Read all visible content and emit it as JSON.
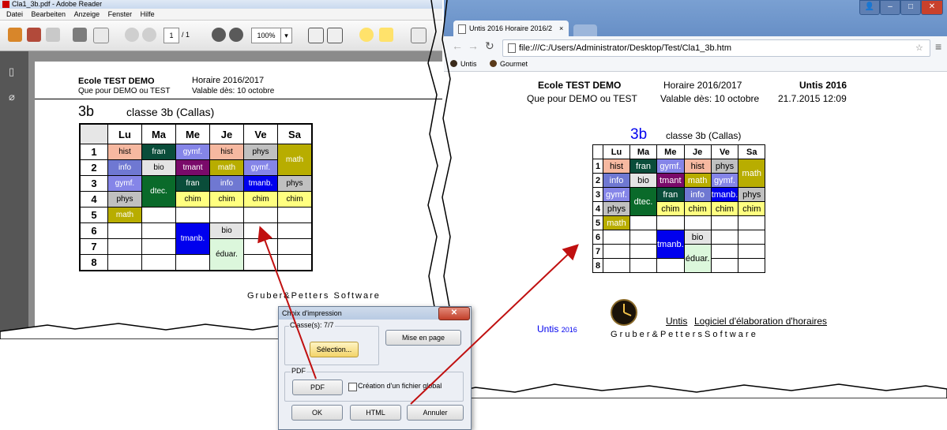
{
  "reader": {
    "title": "Cla1_3b.pdf - Adobe Reader",
    "menu": [
      "Datei",
      "Bearbeiten",
      "Anzeige",
      "Fenster",
      "Hilfe"
    ],
    "page_input": "1",
    "page_total": "/ 1",
    "zoom": "100%"
  },
  "school": {
    "name": "Ecole TEST  DEMO",
    "subtitle": "Que pour DEMO ou TEST",
    "schedule": "Horaire 2016/2017",
    "valid": "Valable dès: 10 octobre"
  },
  "pdf_class": {
    "code": "3b",
    "name": "classe 3b (Callas)"
  },
  "days": [
    "Lu",
    "Ma",
    "Me",
    "Je",
    "Ve",
    "Sa"
  ],
  "periods": [
    "1",
    "2",
    "3",
    "4",
    "5",
    "6",
    "7",
    "8"
  ],
  "lessons": {
    "hist": {
      "label": "hist",
      "bg": "#f6b8a0",
      "fg": "#000000"
    },
    "fran": {
      "label": "fran",
      "bg": "#0a4d3a",
      "fg": "#ffffff"
    },
    "gymf": {
      "label": "gymf.",
      "bg": "#8585e8",
      "fg": "#ffffff"
    },
    "phys": {
      "label": "phys",
      "bg": "#c0c0c0",
      "fg": "#000000"
    },
    "math": {
      "label": "math",
      "bg": "#b8ad00",
      "fg": "#ffffff"
    },
    "info": {
      "label": "info",
      "bg": "#6f78d2",
      "fg": "#ffffff"
    },
    "bio": {
      "label": "bio",
      "bg": "#e4e4e4",
      "fg": "#000000"
    },
    "tmant": {
      "label": "tmant",
      "bg": "#7a0a6a",
      "fg": "#ffffff"
    },
    "dtec": {
      "label": "dtec.",
      "bg": "#0a6a2a",
      "fg": "#ffffff"
    },
    "tmanb": {
      "label": "tmanb.",
      "bg": "#0000ee",
      "fg": "#ffffff"
    },
    "chim": {
      "label": "chim",
      "bg": "#ffff80",
      "fg": "#000000"
    },
    "educ": {
      "label": "éduar.",
      "bg": "#dcf7dc",
      "fg": "#000000"
    }
  },
  "pdf_footer": "Gruber&Petters Software",
  "browser": {
    "tab_title": "Untis 2016 Horaire 2016/2",
    "url": "file:///C:/Users/Administrator/Desktop/Test/Cla1_3b.htm",
    "bookmarks": [
      "Untis",
      "Gourmet"
    ]
  },
  "html_header": {
    "name": "Ecole TEST DEMO",
    "subtitle": "Que pour DEMO ou TEST",
    "schedule": "Horaire 2016/2017",
    "valid": "Valable dès: 10 octobre",
    "product": "Untis 2016",
    "timestamp": "21.7.2015 12:09"
  },
  "html_class": {
    "code": "3b",
    "name": "classe 3b (Callas)"
  },
  "html_footer": {
    "untis": "Untis",
    "year": "2016",
    "link_untis": "Untis",
    "link_rest": "Logiciel d'élaboration d'horaires",
    "credit": "G r u b e r & P e t t e r s S o f t w a r e"
  },
  "dialog": {
    "title": "Choix d'impression",
    "classes_label": "Classe(s): 7/7",
    "selection_btn": "Sélection...",
    "layout_btn": "Mise en page",
    "pdf_group": "PDF",
    "pdf_btn": "PDF",
    "global_file_label": "Création d'un fichier global",
    "ok_btn": "OK",
    "html_btn": "HTML",
    "cancel_btn": "Annuler"
  }
}
